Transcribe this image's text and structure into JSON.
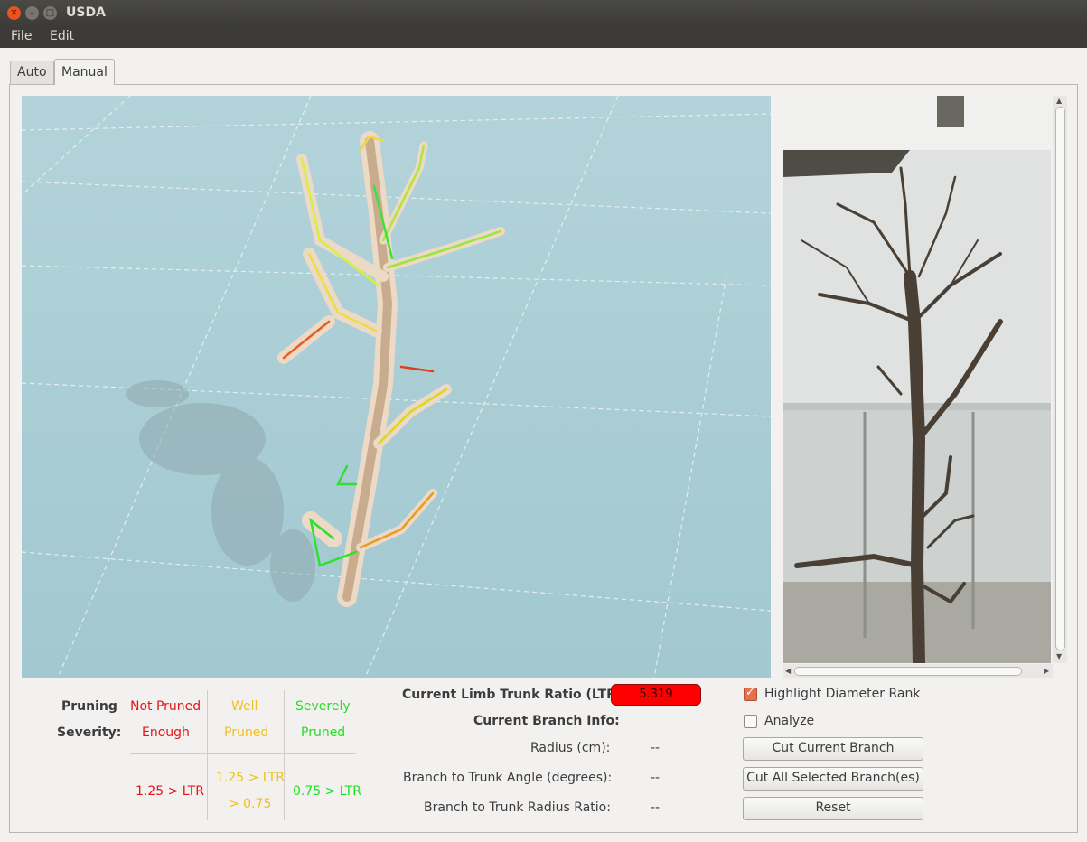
{
  "window": {
    "title": "USDA"
  },
  "menu": {
    "file": "File",
    "edit": "Edit"
  },
  "tabs": [
    {
      "label": "Auto"
    },
    {
      "label": "Manual",
      "active": true
    }
  ],
  "legend": {
    "title_line1": "Pruning",
    "title_line2": "Severity:",
    "not_pruned_1": "Not Pruned",
    "not_pruned_2": "Enough",
    "well_1": "Well",
    "well_2": "Pruned",
    "severe_1": "Severely",
    "severe_2": "Pruned",
    "range_not": "1.25 > LTR",
    "range_well_1": "1.25 > LTR",
    "range_well_2": "> 0.75",
    "range_severe": "0.75 > LTR",
    "colors": {
      "not_pruned": "#e81414",
      "well": "#f0c020",
      "severe": "#22e022"
    }
  },
  "info": {
    "ltr_label": "Current Limb Trunk Ratio (LTR):",
    "ltr_value": "5.319",
    "ltr_color": "#ff0000",
    "branch_info_label": "Current Branch Info:",
    "radius_label": "Radius (cm):",
    "radius_value": "--",
    "angle_label": "Branch to Trunk Angle (degrees):",
    "angle_value": "--",
    "ratio_label": "Branch to Trunk Radius Ratio:",
    "ratio_value": "--"
  },
  "controls": {
    "highlight_label": "Highlight Diameter Rank",
    "highlight_checked": true,
    "analyze_label": "Analyze",
    "analyze_checked": false,
    "cut_current": "Cut Current Branch",
    "cut_all": "Cut All Selected Branch(es)",
    "reset": "Reset"
  }
}
